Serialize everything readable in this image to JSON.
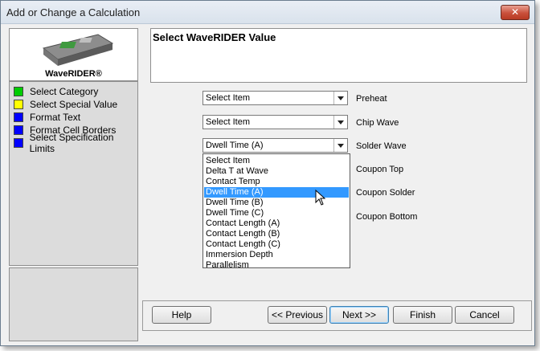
{
  "window": {
    "title": "Add or Change a Calculation",
    "close_glyph": "✕"
  },
  "logo": {
    "label": "WaveRIDER®"
  },
  "categories": [
    {
      "label": "Select Category",
      "color": "#00cc00"
    },
    {
      "label": "Select Special Value",
      "color": "#ffff00"
    },
    {
      "label": "Format Text",
      "color": "#0000ff"
    },
    {
      "label": "Format Cell Borders",
      "color": "#0000ff"
    },
    {
      "label": "Select Specification Limits",
      "color": "#0000ff"
    }
  ],
  "header": {
    "title": "Select WaveRIDER Value"
  },
  "rows": [
    {
      "label": "Preheat",
      "value": "Select Item"
    },
    {
      "label": "Chip Wave",
      "value": "Select Item"
    },
    {
      "label": "Solder Wave",
      "value": "Dwell Time (A)"
    },
    {
      "label": "Coupon Top"
    },
    {
      "label": "Coupon Solder"
    },
    {
      "label": "Coupon Bottom"
    }
  ],
  "dropdown": {
    "options": [
      "Select Item",
      "Delta T at Wave",
      "Contact Temp",
      "Dwell Time (A)",
      "Dwell Time (B)",
      "Dwell Time (C)",
      "Contact Length (A)",
      "Contact Length (B)",
      "Contact Length (C)",
      "Immersion Depth",
      "Parallelism"
    ],
    "selected": "Dwell Time (A)"
  },
  "buttons": {
    "help": "Help",
    "previous": "<< Previous",
    "next": "Next >>",
    "finish": "Finish",
    "cancel": "Cancel"
  },
  "colors": {
    "selection": "#3399ff"
  }
}
